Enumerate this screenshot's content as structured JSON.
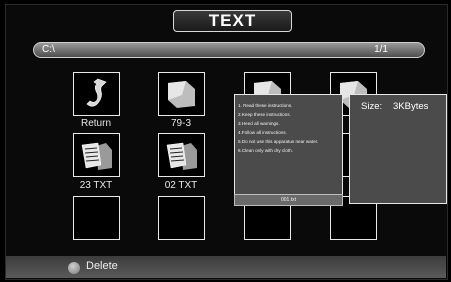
{
  "title": "TEXT",
  "path_bar": {
    "path": "C:\\",
    "page": "1/1"
  },
  "tiles": [
    {
      "label": "Return",
      "icon": "return-arrow-icon"
    },
    {
      "label": "79-3",
      "icon": "folder-icon"
    },
    {
      "label": "",
      "icon": "folder-icon"
    },
    {
      "label": "",
      "icon": "folder-icon"
    },
    {
      "label": "23 TXT",
      "icon": "text-file-icon"
    },
    {
      "label": "02 TXT",
      "icon": "text-file-icon"
    },
    {
      "label": "",
      "icon": ""
    },
    {
      "label": "",
      "icon": ""
    },
    {
      "label": "",
      "icon": ""
    },
    {
      "label": "",
      "icon": ""
    }
  ],
  "preview": {
    "lines": [
      "1. Read these instructions.",
      "2.Keep these instructions.",
      "3.Heed all warnings.",
      "4.Follow all instructions.",
      "5.Do not use this apparatus near water.",
      "6.Clean only with dry cloth."
    ],
    "filename": "001.txt"
  },
  "info": {
    "size_label": "Size:",
    "size_value": "3KBytes"
  },
  "bottom": {
    "delete_label": "Delete",
    "button_color": "gray"
  }
}
